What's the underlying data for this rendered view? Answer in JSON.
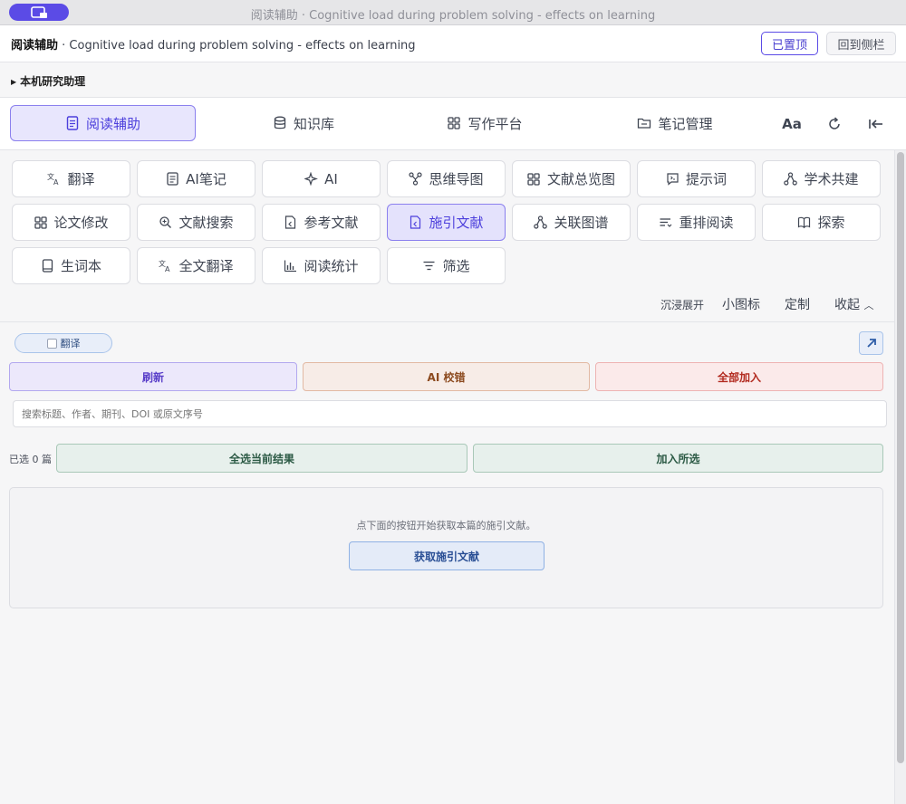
{
  "window": {
    "title": "阅读辅助 · Cognitive load during problem solving - effects on learning"
  },
  "header": {
    "app_name": "阅读辅助",
    "separator": " · ",
    "doc_title": "Cognitive load during problem solving - effects on learning",
    "pin_label": "已置顶",
    "sidebar_label": "回到侧栏"
  },
  "assistant": {
    "label": "本机研究助理"
  },
  "nav": {
    "tabs": [
      {
        "label": "阅读辅助",
        "icon": "document-icon"
      },
      {
        "label": "知识库",
        "icon": "database-icon"
      },
      {
        "label": "写作平台",
        "icon": "grid-icon"
      },
      {
        "label": "笔记管理",
        "icon": "folder-icon"
      }
    ],
    "font_label": "Aa"
  },
  "tools": [
    {
      "label": "翻译",
      "icon": "translate-icon"
    },
    {
      "label": "AI笔记",
      "icon": "note-icon"
    },
    {
      "label": "AI",
      "icon": "sparkle-icon"
    },
    {
      "label": "思维导图",
      "icon": "mindmap-icon"
    },
    {
      "label": "文献总览图",
      "icon": "grid-icon"
    },
    {
      "label": "提示词",
      "icon": "prompt-icon"
    },
    {
      "label": "学术共建",
      "icon": "network-icon"
    },
    {
      "label": "论文修改",
      "icon": "grid-icon"
    },
    {
      "label": "文献搜索",
      "icon": "search-icon"
    },
    {
      "label": "参考文献",
      "icon": "file-icon"
    },
    {
      "label": "施引文献",
      "icon": "file-icon"
    },
    {
      "label": "关联图谱",
      "icon": "network-icon"
    },
    {
      "label": "重排阅读",
      "icon": "lines-icon"
    },
    {
      "label": "探索",
      "icon": "book-icon"
    },
    {
      "label": "生词本",
      "icon": "notebook-icon"
    },
    {
      "label": "全文翻译",
      "icon": "translate-icon"
    },
    {
      "label": "阅读统计",
      "icon": "bar-chart-icon"
    },
    {
      "label": "筛选",
      "icon": "filter-icon"
    }
  ],
  "tool_footer": {
    "immersive": "沉浸展开",
    "small_icons": "小图标",
    "customize": "定制",
    "collapse": "收起"
  },
  "panel": {
    "chip_label": "翻译",
    "refresh": "刷新",
    "ai_check": "AI 校错",
    "add_all": "全部加入",
    "search_placeholder": "搜索标题、作者、期刊、DOI 或原文序号",
    "selected_count": "已选 0 篇",
    "select_all": "全选当前结果",
    "add_selected": "加入所选",
    "empty_message": "点下面的按钮开始获取本篇的施引文献。",
    "fetch_button": "获取施引文献"
  },
  "colors": {
    "accent": "#5b4be6",
    "active_bg": "#e4e2fc"
  }
}
